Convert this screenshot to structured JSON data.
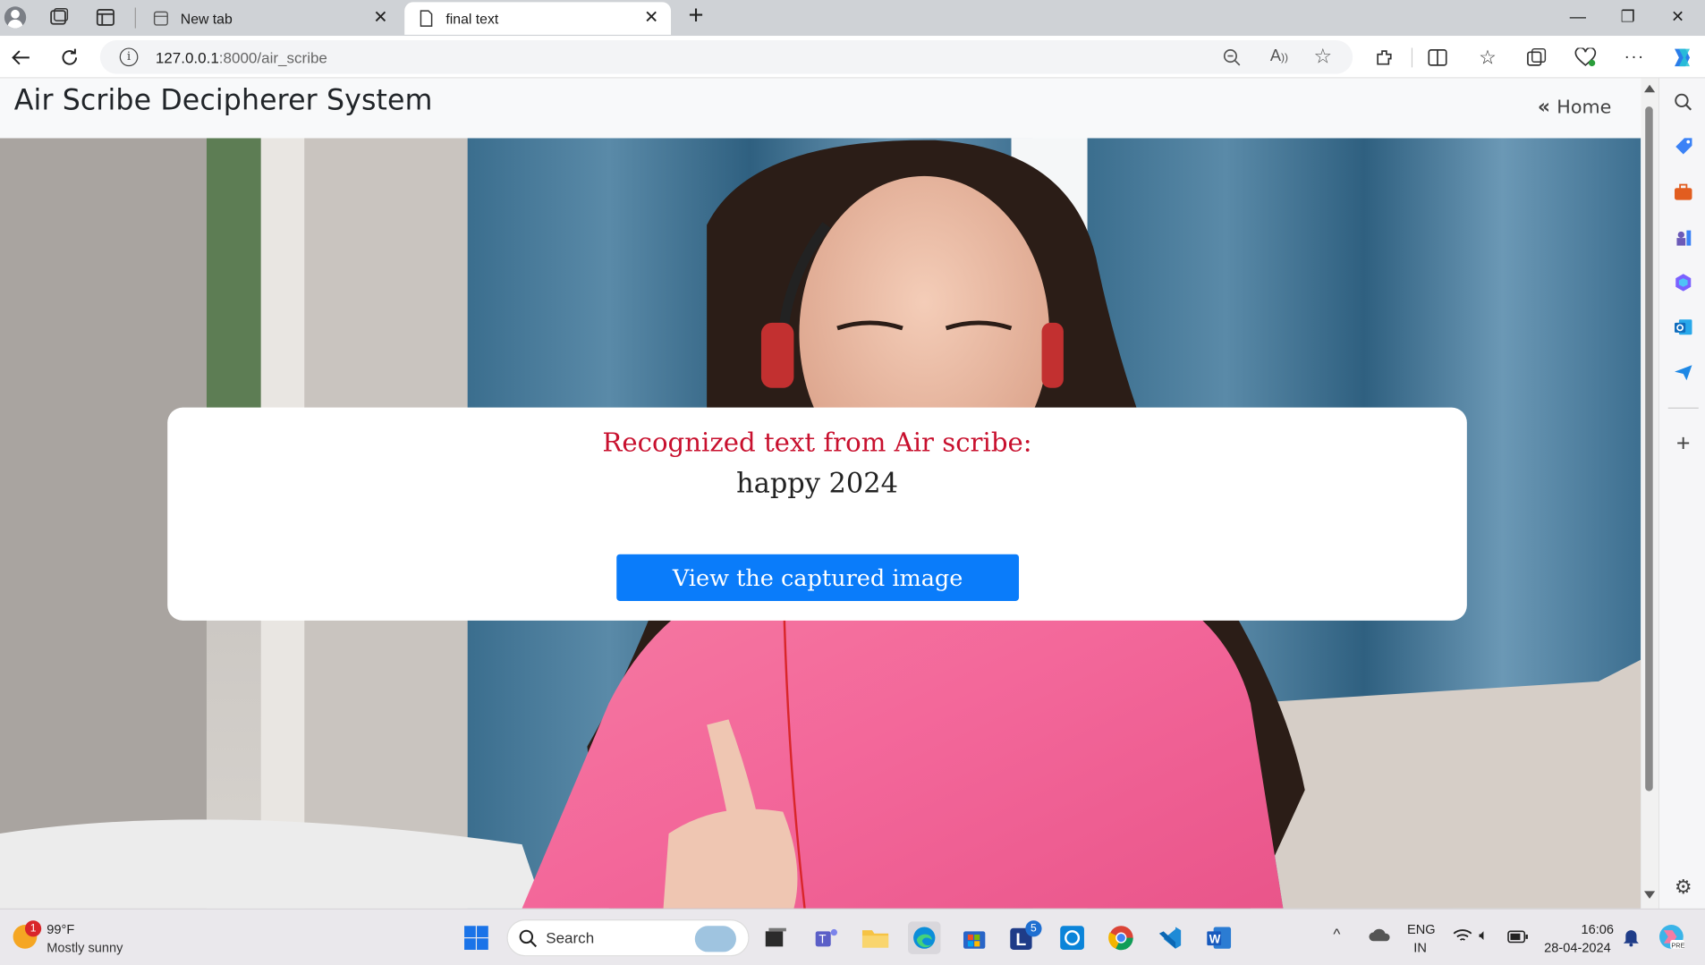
{
  "browser": {
    "tabs": [
      {
        "label": "New tab"
      },
      {
        "label": "final text"
      }
    ],
    "new_tab_symbol": "+",
    "url_host": "127.0.0.1",
    "url_path": ":8000/air_scribe"
  },
  "app": {
    "brand": "Air Scribe Decipherer System",
    "home_label": "Home"
  },
  "result": {
    "title": "Recognized text from Air scribe:",
    "text": "happy 2024",
    "button_label": "View the captured image"
  },
  "taskbar": {
    "weather_temp": "99°F",
    "weather_desc": "Mostly sunny",
    "weather_badge": "1",
    "search_label": "Search",
    "lang_top": "ENG",
    "lang_bottom": "IN",
    "time": "16:06",
    "date": "28-04-2024",
    "outlook_badge": "5"
  },
  "colors": {
    "accent": "#0a7cfa",
    "title_red": "#c8102e"
  }
}
